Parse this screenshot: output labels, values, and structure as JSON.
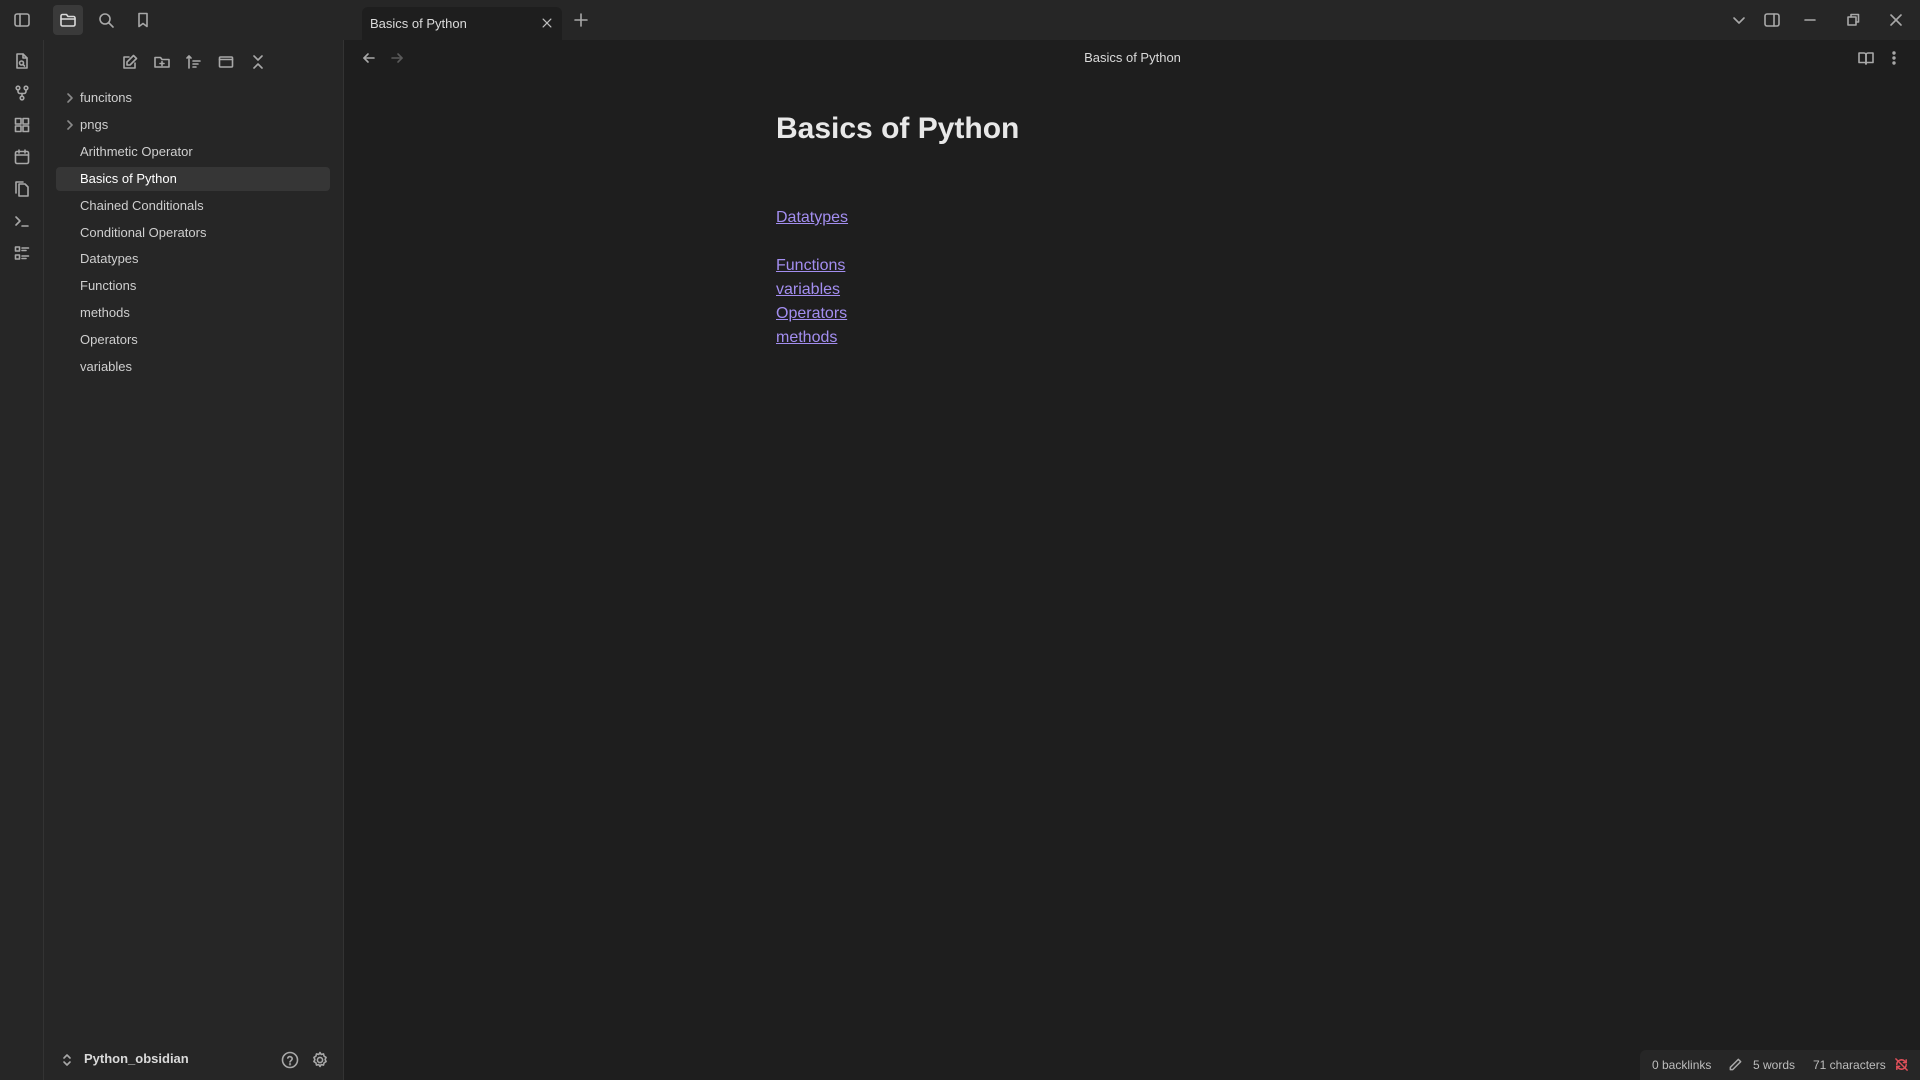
{
  "window": {
    "tab_title": "Basics of Python"
  },
  "icons": {
    "sidebar_toggle": "sidebar-toggle-icon",
    "files": "folder-icon",
    "search": "search-icon",
    "bookmarks": "bookmark-icon",
    "close_tab": "close-icon",
    "new_tab": "plus-icon",
    "tab_list": "chevron-down-icon",
    "right_sidebar": "right-sidebar-icon",
    "minimize": "minimize-icon",
    "restore": "restore-icon",
    "close_window": "close-icon"
  },
  "sidebar": {
    "tree": [
      {
        "label": "funcitons",
        "type": "folder"
      },
      {
        "label": "pngs",
        "type": "folder"
      },
      {
        "label": "Arithmetic Operator",
        "type": "file"
      },
      {
        "label": "Basics of Python",
        "type": "file",
        "active": true
      },
      {
        "label": "Chained Conditionals",
        "type": "file"
      },
      {
        "label": "Conditional Operators",
        "type": "file"
      },
      {
        "label": "Datatypes",
        "type": "file"
      },
      {
        "label": "Functions",
        "type": "file"
      },
      {
        "label": "methods",
        "type": "file"
      },
      {
        "label": "Operators",
        "type": "file"
      },
      {
        "label": "variables",
        "type": "file"
      }
    ],
    "vault_name": "Python_obsidian"
  },
  "editor": {
    "view_title": "Basics of Python",
    "doc_title": "Basics of Python",
    "links": [
      "Datatypes",
      "Functions",
      "variables",
      "Operators",
      "methods"
    ]
  },
  "status": {
    "backlinks": "0 backlinks",
    "words": "5 words",
    "characters": "71 characters"
  },
  "colors": {
    "accent_link": "#a38ef0",
    "background": "#1e1e1e",
    "panel": "#262626",
    "sync_error": "#e0505a"
  }
}
